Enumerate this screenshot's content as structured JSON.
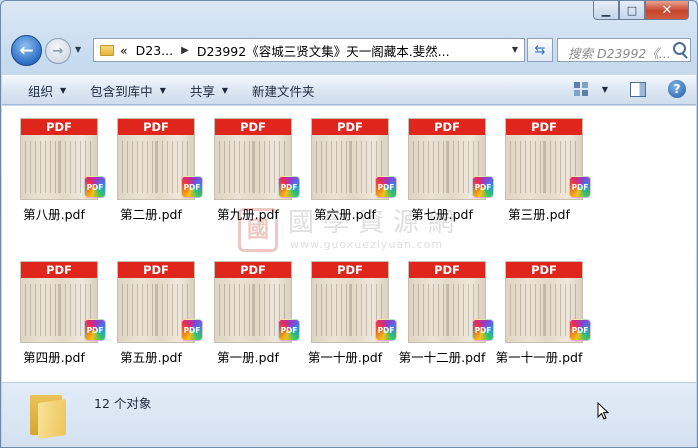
{
  "window": {
    "caption_buttons": [
      "minimize",
      "maximize",
      "close"
    ],
    "caption_glyphs": {
      "minimize": "▁",
      "maximize": "□",
      "close": "✕"
    }
  },
  "nav": {
    "address": {
      "overflow": "«",
      "crumbs": [
        "D23...",
        "D23992《容城三贤文集》天一阁藏本.斐然..."
      ]
    },
    "search_placeholder": "搜索 D23992《..."
  },
  "toolbar": {
    "organize": "组织",
    "include_in_library": "包含到库中",
    "share": "共享",
    "new_folder": "新建文件夹"
  },
  "files": [
    {
      "name": "第八册.pdf",
      "band": "PDF",
      "badge": "PDF"
    },
    {
      "name": "第二册.pdf",
      "band": "PDF",
      "badge": "PDF"
    },
    {
      "name": "第九册.pdf",
      "band": "PDF",
      "badge": "PDF"
    },
    {
      "name": "第六册.pdf",
      "band": "PDF",
      "badge": "PDF"
    },
    {
      "name": "第七册.pdf",
      "band": "PDF",
      "badge": "PDF"
    },
    {
      "name": "第三册.pdf",
      "band": "PDF",
      "badge": "PDF"
    },
    {
      "name": "第四册.pdf",
      "band": "PDF",
      "badge": "PDF"
    },
    {
      "name": "第五册.pdf",
      "band": "PDF",
      "badge": "PDF"
    },
    {
      "name": "第一册.pdf",
      "band": "PDF",
      "badge": "PDF"
    },
    {
      "name": "第一十册.pdf",
      "band": "PDF",
      "badge": "PDF"
    },
    {
      "name": "第一十二册.pdf",
      "band": "PDF",
      "badge": "PDF"
    },
    {
      "name": "第一十一册.pdf",
      "band": "PDF",
      "badge": "PDF"
    }
  ],
  "watermark": {
    "title": "國學資源網",
    "url": "www.guoxueziyuan.com",
    "seal": "國"
  },
  "status": {
    "count_text": "12 个对象"
  },
  "colors": {
    "pdf_band": "#e0251c",
    "window_frame": "#c7dbef",
    "content_bg": "#ffffff"
  }
}
